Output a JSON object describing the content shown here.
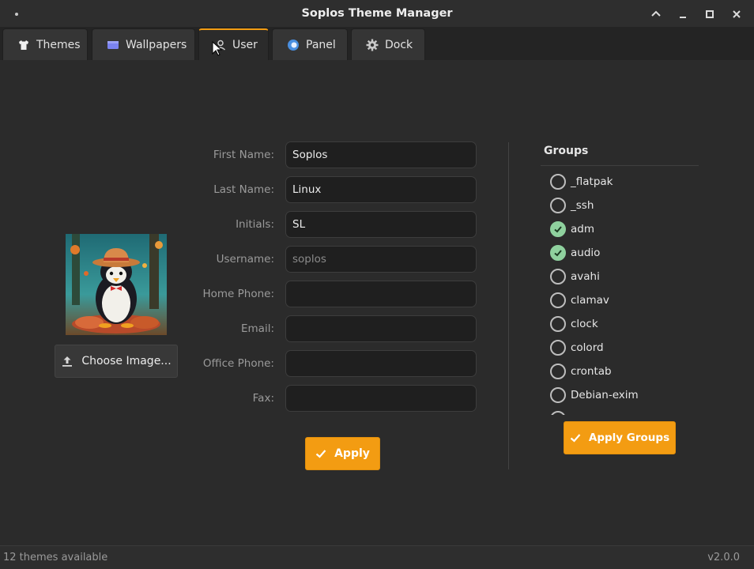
{
  "window": {
    "title": "Soplos Theme Manager"
  },
  "tabs": [
    {
      "label": "Themes",
      "icon": "shirt-icon"
    },
    {
      "label": "Wallpapers",
      "icon": "image-icon"
    },
    {
      "label": "User",
      "icon": "user-icon",
      "active": true
    },
    {
      "label": "Panel",
      "icon": "panel-icon"
    },
    {
      "label": "Dock",
      "icon": "gear-icon"
    }
  ],
  "user": {
    "choose_image_label": "Choose Image...",
    "fields": [
      {
        "label": "First Name:",
        "value": "Soplos"
      },
      {
        "label": "Last Name:",
        "value": "Linux"
      },
      {
        "label": "Initials:",
        "value": "SL"
      },
      {
        "label": "Username:",
        "value": "soplos",
        "disabled": true
      },
      {
        "label": "Home Phone:",
        "value": ""
      },
      {
        "label": "Email:",
        "value": ""
      },
      {
        "label": "Office Phone:",
        "value": ""
      },
      {
        "label": "Fax:",
        "value": ""
      }
    ],
    "apply_label": "Apply"
  },
  "groups": {
    "title": "Groups",
    "items": [
      {
        "name": "_flatpak",
        "checked": false
      },
      {
        "name": "_ssh",
        "checked": false
      },
      {
        "name": "adm",
        "checked": true
      },
      {
        "name": "audio",
        "checked": true
      },
      {
        "name": "avahi",
        "checked": false
      },
      {
        "name": "clamav",
        "checked": false
      },
      {
        "name": "clock",
        "checked": false
      },
      {
        "name": "colord",
        "checked": false
      },
      {
        "name": "crontab",
        "checked": false
      },
      {
        "name": "Debian-exim",
        "checked": false
      }
    ],
    "apply_label": "Apply Groups"
  },
  "status": {
    "left": "12 themes available",
    "right": "v2.0.0"
  },
  "colors": {
    "accent": "#f39c12",
    "checked": "#8fd19e",
    "background": "#2b2b2b"
  }
}
